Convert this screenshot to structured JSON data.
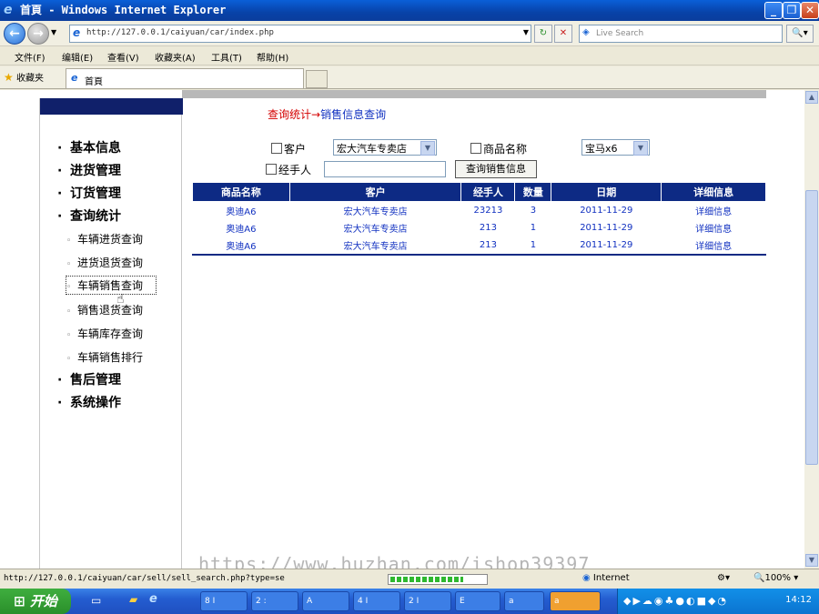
{
  "window": {
    "title": "首頁 - Windows Internet Explorer"
  },
  "address": {
    "url": "http://127.0.0.1/caiyuan/car/index.php",
    "search_placeholder": "Live Search"
  },
  "menu": [
    "文件(F)",
    "编辑(E)",
    "查看(V)",
    "收藏夹(A)",
    "工具(T)",
    "帮助(H)"
  ],
  "favorites_label": "收藏夹",
  "tab_title": "首頁",
  "sidebar": {
    "sections": [
      {
        "label": "基本信息"
      },
      {
        "label": "进货管理"
      },
      {
        "label": "订货管理"
      },
      {
        "label": "查询统计",
        "items": [
          "车辆进货查询",
          "进货退货查询",
          "车辆销售查询",
          "销售退货查询",
          "车辆库存查询",
          "车辆销售排行"
        ]
      },
      {
        "label": "售后管理"
      },
      {
        "label": "系统操作"
      }
    ],
    "selected_item": "车辆销售查询"
  },
  "breadcrumb": {
    "part1": "查询统计→",
    "part2": "销售信息查询"
  },
  "filters": {
    "customer_label": "客户",
    "customer_value": "宏大汽车专卖店",
    "product_label": "商品名称",
    "product_value": "宝马x6",
    "handler_label": "经手人",
    "handler_value": "",
    "search_button": "查询销售信息"
  },
  "table": {
    "columns": [
      "商品名称",
      "客户",
      "经手人",
      "数量",
      "日期",
      "详细信息"
    ],
    "rows": [
      [
        "奥迪A6",
        "宏大汽车专卖店",
        "23213",
        "3",
        "2011-11-29",
        "详细信息"
      ],
      [
        "奥迪A6",
        "宏大汽车专卖店",
        "213",
        "1",
        "2011-11-29",
        "详细信息"
      ],
      [
        "奥迪A6",
        "宏大汽车专卖店",
        "213",
        "1",
        "2011-11-29",
        "详细信息"
      ]
    ]
  },
  "status": {
    "url": "http://127.0.0.1/caiyuan/car/sell/sell_search.php?type=se",
    "zone": "Internet",
    "zoom": "100%"
  },
  "taskbar": {
    "start": "开始",
    "items": [
      "8 I",
      "2 :",
      "A",
      "4 I",
      "2 I",
      "E",
      "a",
      "a"
    ],
    "clock": "14:12"
  },
  "watermark": "https://www.huzhan.com/ishop39397"
}
